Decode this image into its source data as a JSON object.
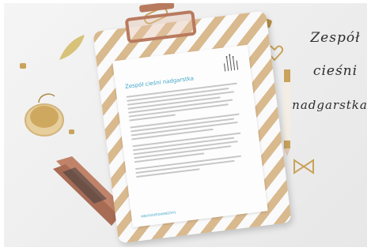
{
  "caption": {
    "line1": "Zespół",
    "line2": "cieśni",
    "line3": "nadgarstka"
  },
  "document": {
    "title": "Zespół cieśni nadgarstka",
    "footer": "MEDYKSPEDIAMEDY.PL"
  },
  "colors": {
    "background": "#f1f1f1",
    "accent_blue": "#3fa6c7",
    "rose_gold": "#b87a5e",
    "gold": "#c9a35b"
  },
  "icons": [
    "hand-skeleton-icon",
    "clip-icon",
    "pen-icon",
    "heart-clip-icon",
    "bow-clip-icon",
    "stapler-icon",
    "jar-icon",
    "leaf-icon"
  ]
}
